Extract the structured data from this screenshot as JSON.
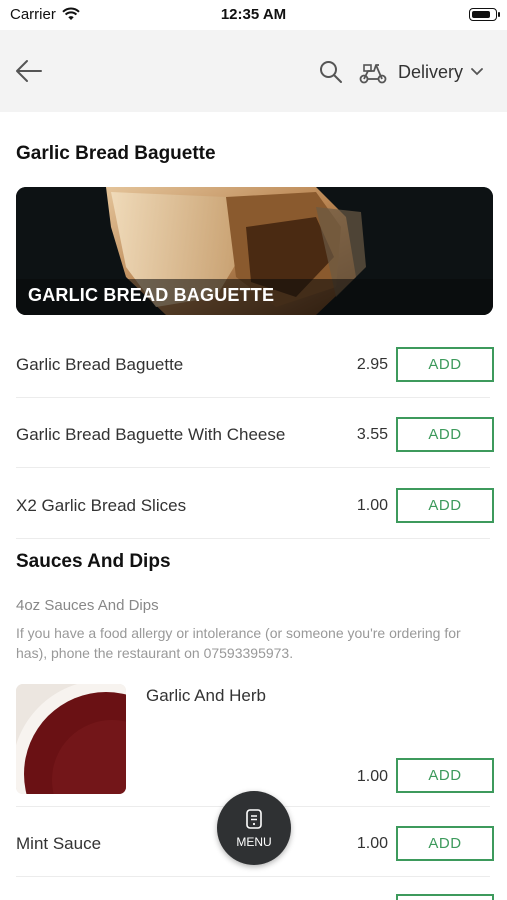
{
  "status_bar": {
    "carrier": "Carrier",
    "time": "12:35 AM",
    "battery_level": 0.85
  },
  "header": {
    "delivery_label": "Delivery",
    "icons": [
      "back-arrow-icon",
      "search-icon",
      "scooter-icon",
      "chevron-down-icon"
    ]
  },
  "sections": [
    {
      "title": "Garlic Bread Baguette",
      "banner_label": "GARLIC BREAD BAGUETTE",
      "items": [
        {
          "name": "Garlic Bread Baguette",
          "price": "2.95",
          "action": "ADD"
        },
        {
          "name": "Garlic Bread Baguette With Cheese",
          "price": "3.55",
          "action": "ADD"
        },
        {
          "name": "X2 Garlic Bread Slices",
          "price": "1.00",
          "action": "ADD"
        }
      ]
    },
    {
      "title": "Sauces And Dips",
      "sub_heading": "4oz Sauces And Dips",
      "note": "If you have a food allergy or intolerance (or someone you're ordering for has), phone the restaurant on 07593395973.",
      "items": [
        {
          "name": "Garlic And Herb",
          "price": "1.00",
          "action": "ADD"
        },
        {
          "name": "Mint Sauce",
          "price": "1.00",
          "action": "ADD"
        }
      ]
    }
  ],
  "fab": {
    "label": "MENU"
  },
  "colors": {
    "accent": "#3d9a5c",
    "header_bg": "#f3f3f3",
    "fab_bg": "#2f3133"
  }
}
